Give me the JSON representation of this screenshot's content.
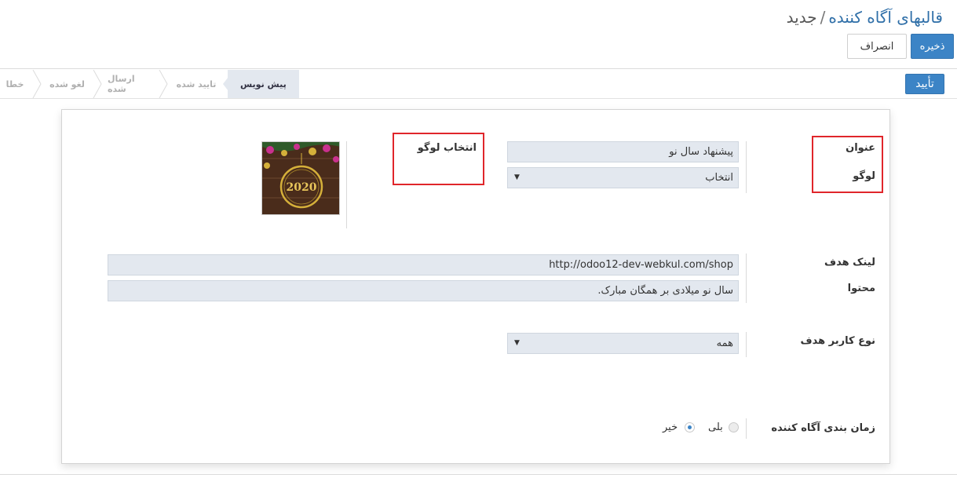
{
  "breadcrumb": {
    "parent": "قالبهای آگاه کننده",
    "separator": "/",
    "current": "جدید"
  },
  "toolbar": {
    "save_label": "ذخیره",
    "discard_label": "انصراف",
    "confirm_label": "تأیید"
  },
  "stages": [
    {
      "label": "پیش نویس",
      "active": true
    },
    {
      "label": "تایید شده",
      "active": false
    },
    {
      "label": "ارسال شده",
      "active": false
    },
    {
      "label": "لغو شده",
      "active": false
    },
    {
      "label": "خطا",
      "active": false
    }
  ],
  "form": {
    "title_label": "عنوان",
    "title_value": "پیشنهاد سال نو",
    "logo_label": "لوگو",
    "logo_select_value": "انتخاب",
    "choose_logo_label": "انتخاب لوگو",
    "logo_image_text": "2020",
    "target_link_label": "لینک هدف",
    "target_link_value": "http://odoo12-dev-webkul.com/shop",
    "content_label": "محتوا",
    "content_value": "سال نو میلادی بر همگان مبارک.",
    "target_user_type_label": "نوع کاربر هدف",
    "target_user_type_value": "همه",
    "schedule_label": "زمان بندی آگاه کننده",
    "schedule_yes": "بلی",
    "schedule_no": "خیر",
    "schedule_selected": "خیر"
  },
  "colors": {
    "primary": "#3c84c6",
    "highlight": "#e0262b",
    "field_bg": "#e3e8ef"
  }
}
